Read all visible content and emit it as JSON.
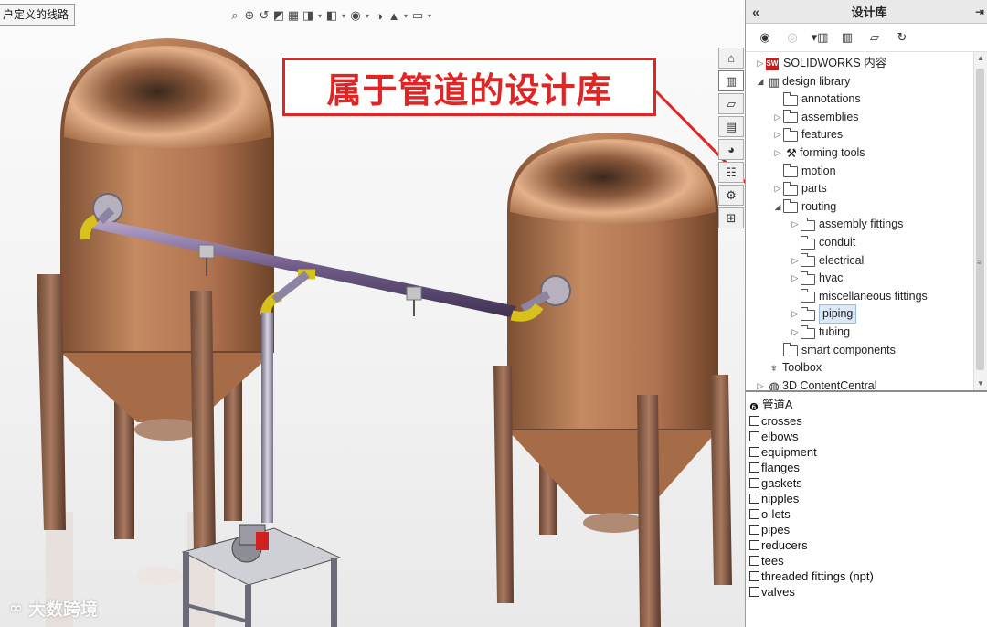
{
  "viewport": {
    "route_tab_label": "户定义的线路",
    "callout_text": "属于管道的设计库",
    "hud_icons": [
      "zoom-to-fit-icon",
      "zoom-area-icon",
      "previous-view-icon",
      "section-view-icon",
      "dynamic-annotation-icon",
      "view-orientation-icon",
      "display-style-icon",
      "hide-show-icon",
      "edit-appearance-icon",
      "apply-scene-icon",
      "view-settings-icon"
    ],
    "watermark_text": "大数跨境",
    "colors": {
      "callout": "#e12525",
      "tank": "#b87a55",
      "pipe": "#6e5a86",
      "elbow": "#d6c21a"
    }
  },
  "taskpane_tabs": [
    "home-tab-icon",
    "design-library-tab-icon",
    "file-explorer-tab-icon",
    "view-palette-tab-icon",
    "appearances-tab-icon",
    "custom-properties-tab-icon",
    "routing-library-tab-icon",
    "routing-tab-icon"
  ],
  "panel": {
    "title": "设计库",
    "collapse_glyph": "«",
    "tree": [
      {
        "label": "SOLIDWORKS 内容",
        "indent": 0,
        "expander": "▷",
        "icon": "sw"
      },
      {
        "label": "design library",
        "indent": 0,
        "expander": "◢",
        "icon": "lib"
      },
      {
        "label": "annotations",
        "indent": 1,
        "expander": "",
        "icon": "folder"
      },
      {
        "label": "assemblies",
        "indent": 1,
        "expander": "▷",
        "icon": "folder"
      },
      {
        "label": "features",
        "indent": 1,
        "expander": "▷",
        "icon": "folder"
      },
      {
        "label": "forming tools",
        "indent": 1,
        "expander": "▷",
        "icon": "tools"
      },
      {
        "label": "motion",
        "indent": 1,
        "expander": "",
        "icon": "folder"
      },
      {
        "label": "parts",
        "indent": 1,
        "expander": "▷",
        "icon": "folder"
      },
      {
        "label": "routing",
        "indent": 1,
        "expander": "◢",
        "icon": "folder"
      },
      {
        "label": "assembly fittings",
        "indent": 2,
        "expander": "▷",
        "icon": "folder"
      },
      {
        "label": "conduit",
        "indent": 2,
        "expander": "",
        "icon": "folder"
      },
      {
        "label": "electrical",
        "indent": 2,
        "expander": "▷",
        "icon": "folder"
      },
      {
        "label": "hvac",
        "indent": 2,
        "expander": "▷",
        "icon": "folder"
      },
      {
        "label": "miscellaneous fittings",
        "indent": 2,
        "expander": "",
        "icon": "folder"
      },
      {
        "label": "piping",
        "indent": 2,
        "expander": "▷",
        "icon": "folder",
        "selected": true
      },
      {
        "label": "tubing",
        "indent": 2,
        "expander": "▷",
        "icon": "folder"
      },
      {
        "label": "smart components",
        "indent": 1,
        "expander": "",
        "icon": "folder"
      },
      {
        "label": "Toolbox",
        "indent": 0,
        "expander": "",
        "icon": "toolbox"
      },
      {
        "label": "3D ContentCentral",
        "indent": 0,
        "expander": "▷",
        "icon": "globe"
      }
    ],
    "files_header": "管道A",
    "files": [
      "crosses",
      "elbows",
      "equipment",
      "flanges",
      "gaskets",
      "nipples",
      "o-lets",
      "pipes",
      "reducers",
      "tees",
      "threaded fittings (npt)",
      "valves"
    ]
  }
}
